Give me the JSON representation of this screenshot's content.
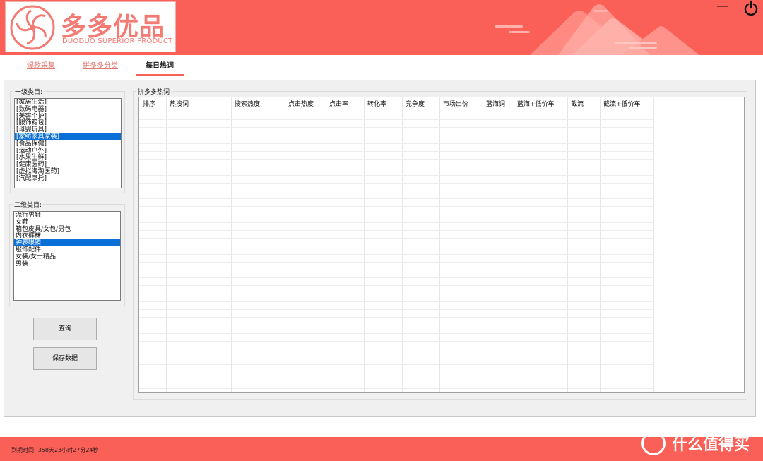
{
  "brand": {
    "title": "多多优品",
    "subtitle": "DUODUO SUPERIOR PRODUCT",
    "accent": "#fb6058"
  },
  "window": {
    "minimize_icon": "minimize-icon",
    "power_icon": "power-icon"
  },
  "tabs": [
    {
      "label": "爆款采集",
      "active": false
    },
    {
      "label": "拼多多分类",
      "active": false
    },
    {
      "label": "每日热词",
      "active": true
    }
  ],
  "level1": {
    "label": "一级类目:",
    "items": [
      "[家居生活]",
      "[数码电器]",
      "[美容个护]",
      "[服饰箱包]",
      "[母婴玩具]",
      "[家纺家具家装]",
      "[食品保健]",
      "[运动户外]",
      "[水果生鲜]",
      "[健康医药]",
      "[虚拟海淘医药]",
      "[汽配摩托]"
    ],
    "selected_index": 5
  },
  "level2": {
    "label": "二级类目:",
    "items": [
      "流行男鞋",
      "女鞋",
      "箱包皮具/女包/男包",
      "内衣裤袜",
      "钟表眼镜",
      "服饰配件",
      "女装/女士精品",
      "男装"
    ],
    "selected_index": 4
  },
  "buttons": {
    "query": "查询",
    "save": "保存数据"
  },
  "grid": {
    "label": "拼多多热词",
    "columns": [
      "排序",
      "热搜词",
      "搜索热度",
      "点击热度",
      "点击率",
      "转化率",
      "竞争度",
      "市场出价",
      "蓝海词",
      "蓝海+低价车",
      "截流",
      "截流+低价车"
    ],
    "rows": []
  },
  "footer": {
    "expire_label": "到期时间:",
    "expire_value": "358天23小时27分24秒"
  },
  "watermark": {
    "text": "什么值得买",
    "icon": "smzdm-logo-icon"
  }
}
